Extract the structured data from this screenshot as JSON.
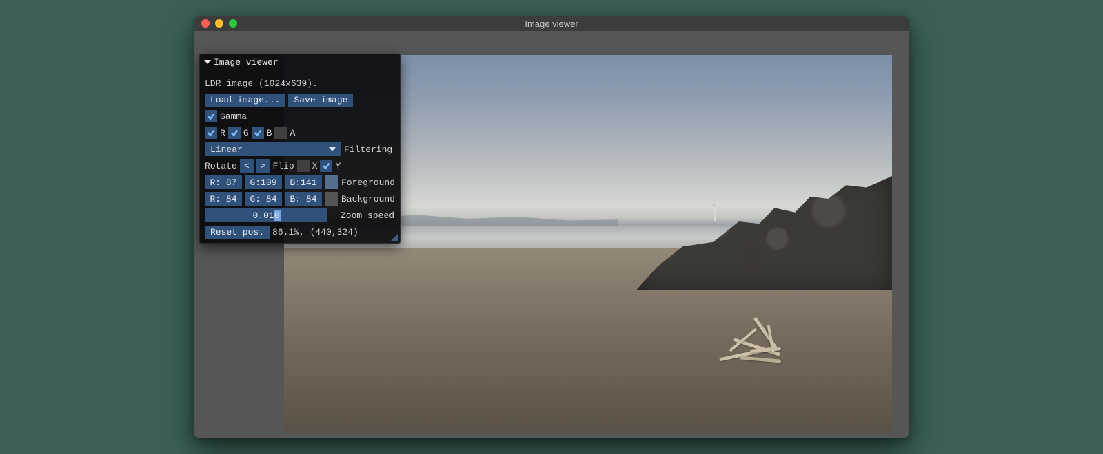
{
  "window": {
    "title": "Image viewer"
  },
  "panel": {
    "title": "Image viewer",
    "image_info": "LDR image (1024x639).",
    "load_label": "Load image...",
    "save_label": "Save image",
    "gamma_label": "Gamma",
    "gamma_checked": true,
    "channels": {
      "r": {
        "label": "R",
        "checked": true
      },
      "g": {
        "label": "G",
        "checked": true
      },
      "b": {
        "label": "B",
        "checked": true
      },
      "a": {
        "label": "A",
        "checked": false
      }
    },
    "filtering": {
      "value": "Linear",
      "label": "Filtering"
    },
    "rotate": {
      "label": "Rotate",
      "left": "<",
      "right": ">"
    },
    "flip": {
      "label": "Flip",
      "x_label": "X",
      "x_checked": false,
      "y_label": "Y",
      "y_checked": true
    },
    "foreground": {
      "r": "R: 87",
      "g": "G:109",
      "b": "B:141",
      "hex": "#576d8d",
      "label": "Foreground"
    },
    "background": {
      "r": "R: 84",
      "g": "G: 84",
      "b": "B: 84",
      "hex": "#545454",
      "label": "Background"
    },
    "zoom_speed": {
      "value": "0.010",
      "label": "Zoom speed"
    },
    "reset": {
      "label": "Reset pos.",
      "status": "86.1%, (440,324)"
    }
  }
}
